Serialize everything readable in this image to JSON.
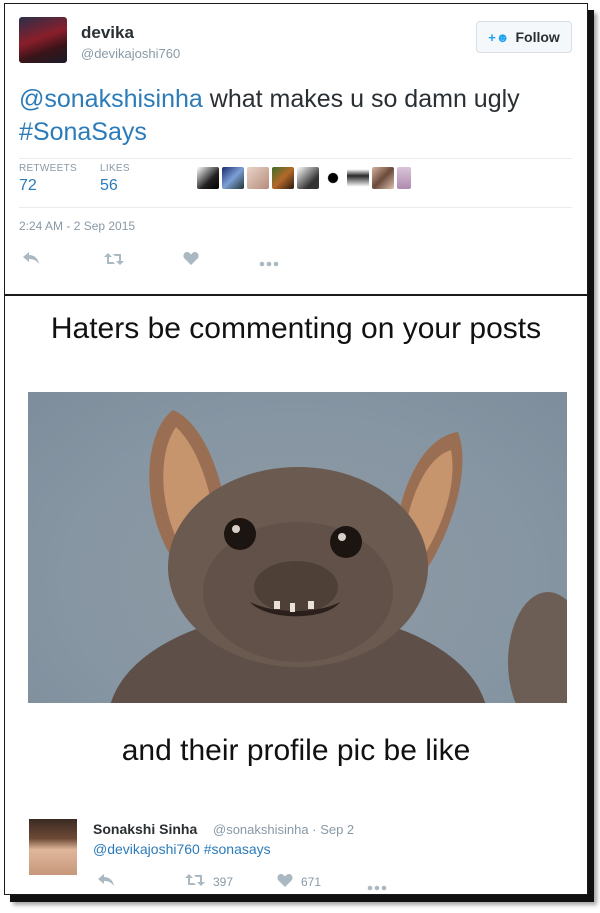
{
  "tweet": {
    "author_name": "devika",
    "author_handle": "@devikajoshi760",
    "follow_label": "Follow",
    "text_mention": "@sonakshisinha",
    "text_body": " what makes u so damn ugly ",
    "text_hashtag": "#SonaSays",
    "retweets_label": "RETWEETS",
    "retweets_count": "72",
    "likes_label": "LIKES",
    "likes_count": "56",
    "timestamp": "2:24 AM - 2 Sep 2015",
    "actions": [
      "reply-icon",
      "retweet-icon",
      "like-icon",
      "more-icon"
    ]
  },
  "meme": {
    "top_caption": "Haters be commenting on your posts",
    "bottom_caption": "and their profile pic be like"
  },
  "reply": {
    "author_name": "Sonakshi Sinha",
    "author_handle": "@sonakshisinha",
    "separator": "·",
    "date": "Sep 2",
    "mention": "@devikajoshi760",
    "hashtag": "#sonasays",
    "retweet_count": "397",
    "like_count": "671"
  },
  "colors": {
    "link": "#2b7bb9",
    "muted": "#8899a6",
    "follow_icon": "#1da1f2"
  }
}
